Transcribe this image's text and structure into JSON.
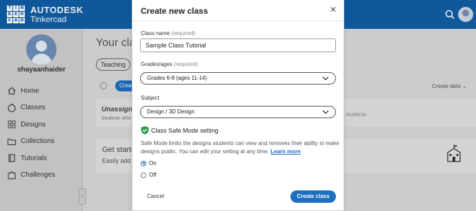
{
  "header": {
    "logo_letters": [
      "T",
      "I",
      "N",
      "K",
      "E",
      "R",
      "C",
      "A",
      "D"
    ],
    "brand_line1": "AUTODESK",
    "brand_line2": "Tinkercad"
  },
  "sidebar": {
    "username": "shayaanhaider",
    "items": [
      {
        "label": "Home",
        "icon": "home-icon"
      },
      {
        "label": "Classes",
        "icon": "apple-icon"
      },
      {
        "label": "Designs",
        "icon": "grid-icon"
      },
      {
        "label": "Collections",
        "icon": "folder-icon"
      },
      {
        "label": "Tutorials",
        "icon": "book-icon"
      },
      {
        "label": "Challenges",
        "icon": "puzzle-icon"
      }
    ],
    "collapse_glyph": "‹"
  },
  "background": {
    "page_title": "Your cla",
    "filter_pill": "Teaching",
    "create_button": "Creat",
    "sort_label": "Create date ⌄",
    "card1_title": "Unassigne",
    "card1_sub": "Students who",
    "card1_right": "students",
    "card2_title": "Get starte",
    "card2_sub": "Easily add"
  },
  "modal": {
    "title": "Create new class",
    "close_glyph": "✕",
    "class_name_label": "Class name",
    "class_name_required": "(required)",
    "class_name_value": "Sample Class Tutorial",
    "grades_label": "Grades/ages",
    "grades_required": "(required)",
    "grades_value": "Grades 6-8 (ages 11-14)",
    "subject_label": "Subject",
    "subject_value": "Design / 3D Design",
    "safe_mode_title": "Class Safe Mode setting",
    "safe_mode_desc": "Safe Mode limits the designs students can view and removes their ability to make designs public. You can edit your setting at any time.",
    "learn_more": "Learn more",
    "radio_on": "On",
    "radio_off": "Off",
    "cancel": "Cancel",
    "create": "Create class"
  },
  "colors": {
    "brand_blue": "#0f5ea5",
    "button_blue": "#1e6ec0",
    "safe_green": "#2e9e4a"
  }
}
